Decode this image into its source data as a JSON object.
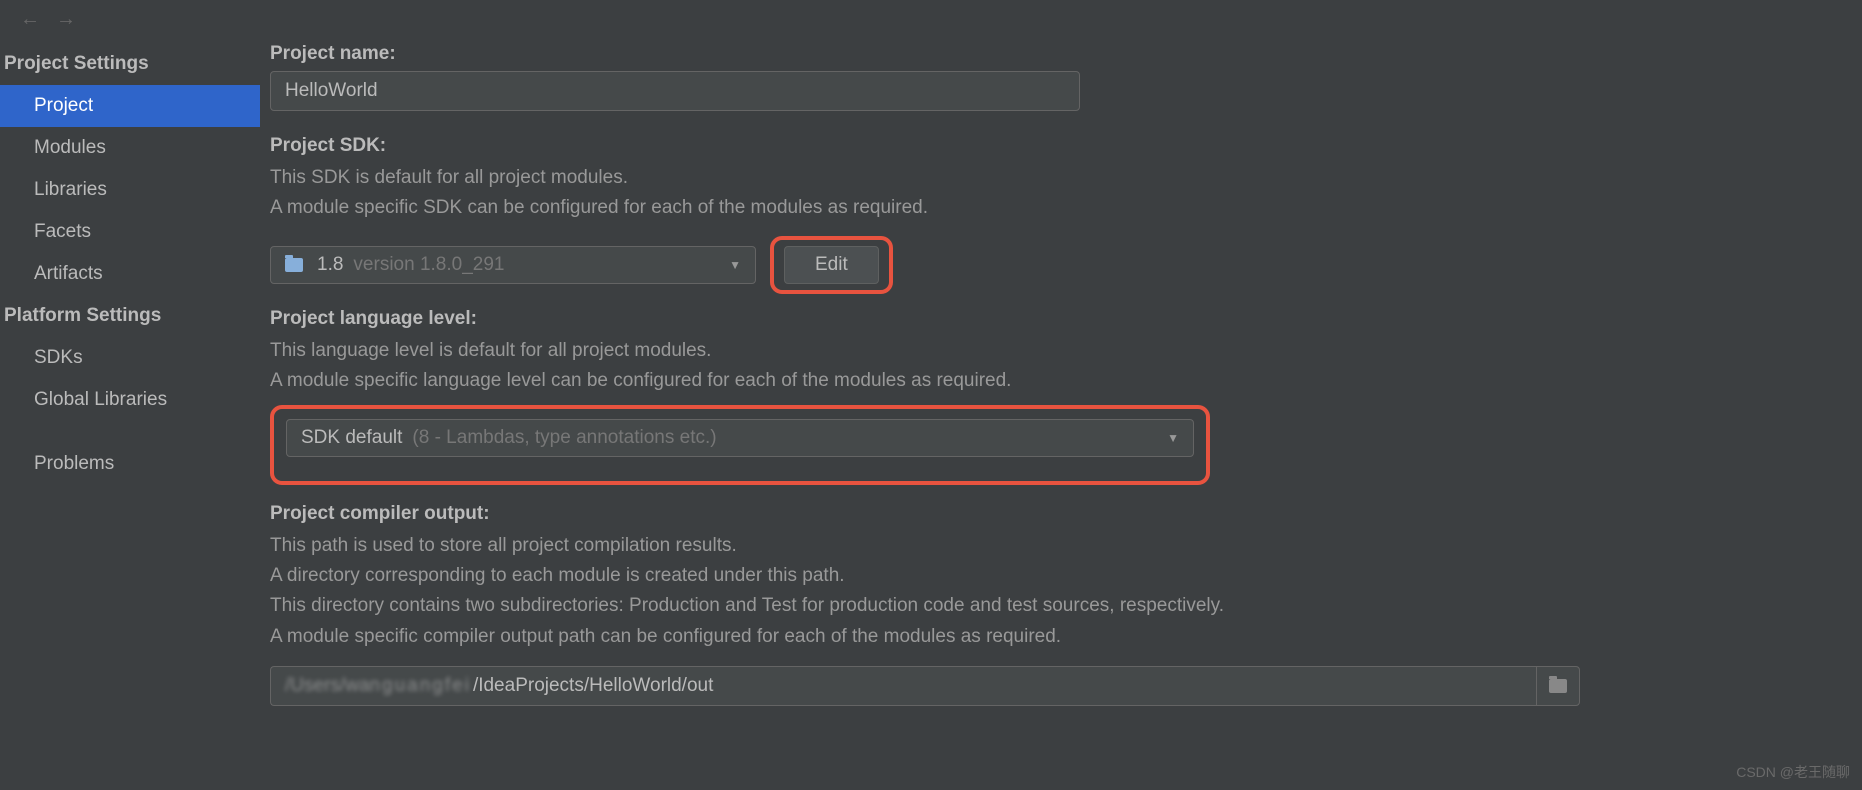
{
  "sidebar": {
    "projectSettingsHeading": "Project Settings",
    "platformSettingsHeading": "Platform Settings",
    "items": {
      "project": "Project",
      "modules": "Modules",
      "libraries": "Libraries",
      "facets": "Facets",
      "artifacts": "Artifacts",
      "sdks": "SDKs",
      "globalLibraries": "Global Libraries",
      "problems": "Problems"
    }
  },
  "main": {
    "projectName": {
      "label": "Project name:",
      "value": "HelloWorld"
    },
    "projectSdk": {
      "label": "Project SDK:",
      "desc1": "This SDK is default for all project modules.",
      "desc2": "A module specific SDK can be configured for each of the modules as required.",
      "sdkName": "1.8",
      "sdkVersion": "version 1.8.0_291",
      "editButton": "Edit"
    },
    "languageLevel": {
      "label": "Project language level:",
      "desc1": "This language level is default for all project modules.",
      "desc2": "A module specific language level can be configured for each of the modules as required.",
      "selectedMain": "SDK default",
      "selectedDetail": "(8 - Lambdas, type annotations etc.)"
    },
    "compilerOutput": {
      "label": "Project compiler output:",
      "desc1": "This path is used to store all project compilation results.",
      "desc2": "A directory corresponding to each module is created under this path.",
      "desc3": "This directory contains two subdirectories: Production and Test for production code and test sources, respectively.",
      "desc4": "A module specific compiler output path can be configured for each of the modules as required.",
      "pathPrefix": "/Users/wan",
      "pathSuffix": "/IdeaProjects/HelloWorld/out"
    }
  },
  "watermark": "CSDN @老王随聊"
}
